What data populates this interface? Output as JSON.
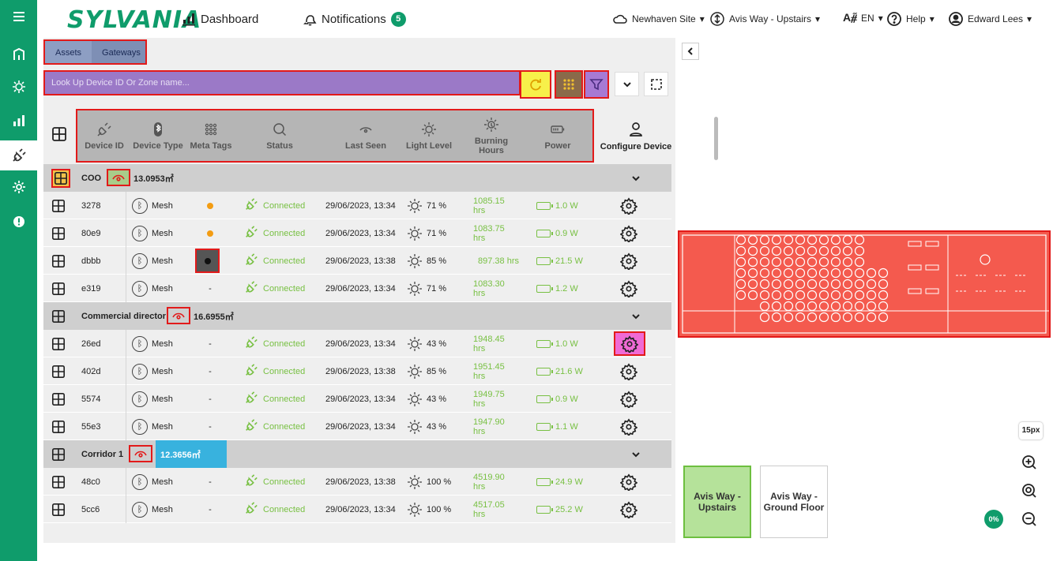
{
  "app": {
    "logo": "SYLVANIA",
    "colors": {
      "brand": "#0f9c6b",
      "connected": "#78c043"
    }
  },
  "nav": {
    "dashboard": "Dashboard",
    "notifications": "Notifications",
    "notifications_count": "5",
    "site": "Newhaven Site",
    "floor": "Avis Way - Upstairs",
    "language": "EN",
    "help": "Help",
    "user": "Edward Lees"
  },
  "tabs": [
    "Assets",
    "Gateways"
  ],
  "search": {
    "placeholder": "Look Up Device ID Or Zone name..."
  },
  "columns": {
    "device_id": "Device ID",
    "device_type": "Device Type",
    "meta_tags": "Meta Tags",
    "status": "Status",
    "last_seen": "Last Seen",
    "light_level": "Light Level",
    "burning_hours": "Burning Hours",
    "power": "Power",
    "configure": "Configure Device"
  },
  "zones": [
    {
      "name": "COO",
      "area": "13.0953㎡",
      "devices": [
        {
          "id": "3278",
          "type": "Mesh",
          "tag": "orange-dot",
          "status": "Connected",
          "last_seen": "29/06/2023, 13:34",
          "light": "71 %",
          "hours": "1085.15 hrs",
          "power": "1.0 W"
        },
        {
          "id": "80e9",
          "type": "Mesh",
          "tag": "orange-dot",
          "status": "Connected",
          "last_seen": "29/06/2023, 13:34",
          "light": "71 %",
          "hours": "1083.75 hrs",
          "power": "0.9 W"
        },
        {
          "id": "dbbb",
          "type": "Mesh",
          "tag": "dark-dot",
          "status": "Connected",
          "last_seen": "29/06/2023, 13:38",
          "light": "85 %",
          "hours": "897.38 hrs",
          "power": "21.5 W"
        },
        {
          "id": "e319",
          "type": "Mesh",
          "tag": "-",
          "status": "Connected",
          "last_seen": "29/06/2023, 13:34",
          "light": "71 %",
          "hours": "1083.30 hrs",
          "power": "1.2 W"
        }
      ]
    },
    {
      "name": "Commercial director",
      "area": "16.6955㎡",
      "devices": [
        {
          "id": "26ed",
          "type": "Mesh",
          "tag": "-",
          "status": "Connected",
          "last_seen": "29/06/2023, 13:34",
          "light": "43 %",
          "hours": "1948.45 hrs",
          "power": "1.0 W"
        },
        {
          "id": "402d",
          "type": "Mesh",
          "tag": "-",
          "status": "Connected",
          "last_seen": "29/06/2023, 13:38",
          "light": "85 %",
          "hours": "1951.45 hrs",
          "power": "21.6 W"
        },
        {
          "id": "5574",
          "type": "Mesh",
          "tag": "-",
          "status": "Connected",
          "last_seen": "29/06/2023, 13:34",
          "light": "43 %",
          "hours": "1949.75 hrs",
          "power": "0.9 W"
        },
        {
          "id": "55e3",
          "type": "Mesh",
          "tag": "-",
          "status": "Connected",
          "last_seen": "29/06/2023, 13:34",
          "light": "43 %",
          "hours": "1947.90 hrs",
          "power": "1.1 W"
        }
      ]
    },
    {
      "name": "Corridor 1",
      "area": "12.3656㎡",
      "devices": [
        {
          "id": "48c0",
          "type": "Mesh",
          "tag": "-",
          "status": "Connected",
          "last_seen": "29/06/2023, 13:38",
          "light": "100 %",
          "hours": "4519.90 hrs",
          "power": "24.9 W"
        },
        {
          "id": "5cc6",
          "type": "Mesh",
          "tag": "-",
          "status": "Connected",
          "last_seen": "29/06/2023, 13:34",
          "light": "100 %",
          "hours": "4517.05 hrs",
          "power": "25.2 W"
        }
      ]
    }
  ],
  "map": {
    "scale_label": "15px",
    "zoom_percent": "0%",
    "floors": [
      "Avis Way - Upstairs",
      "Avis Way - Ground Floor"
    ]
  }
}
